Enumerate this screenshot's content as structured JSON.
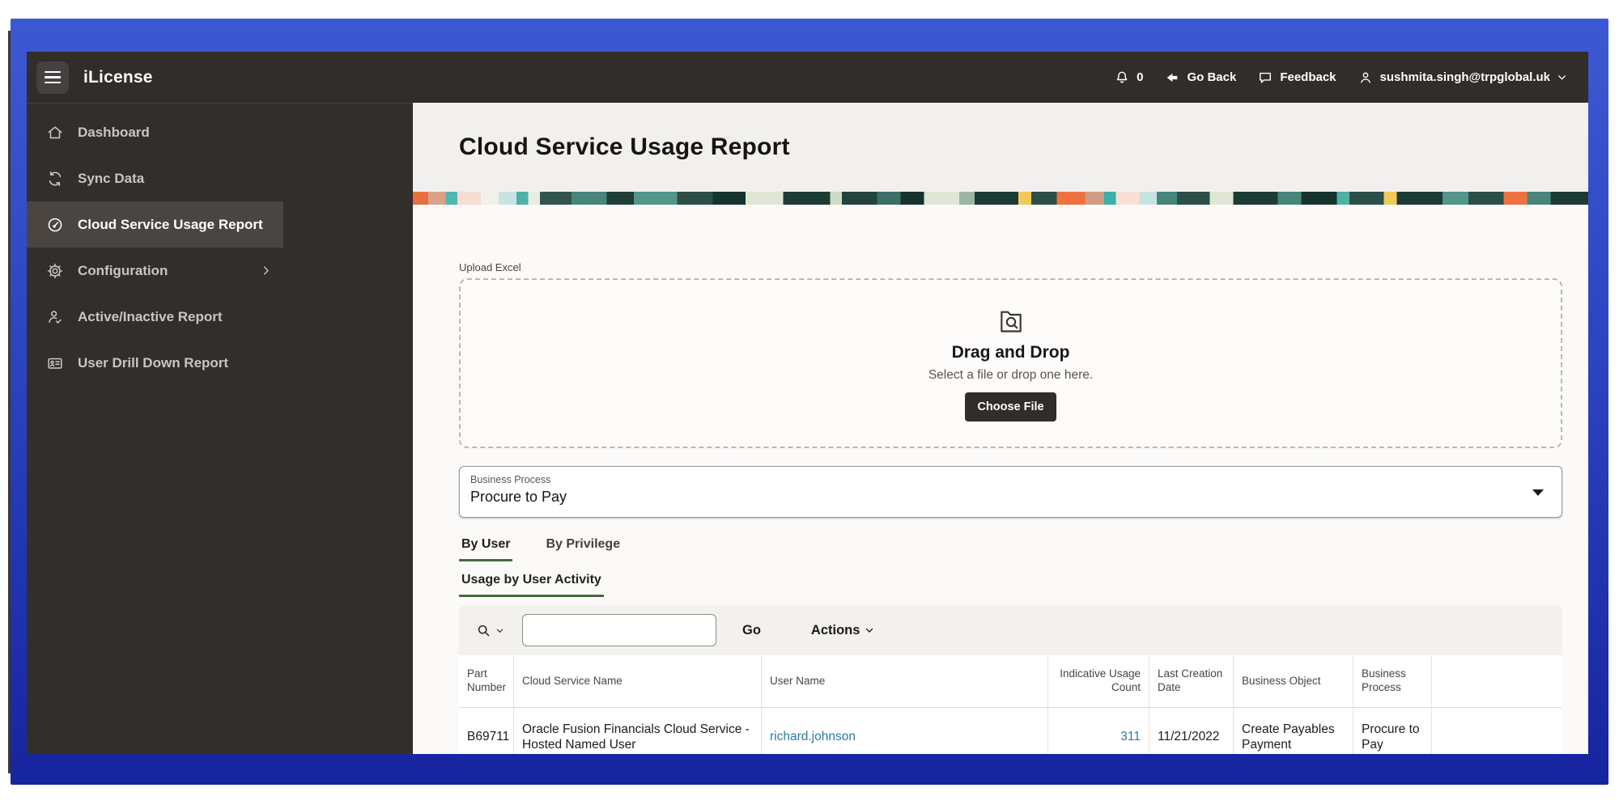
{
  "app": {
    "title": "iLicense"
  },
  "header": {
    "notifications_count": "0",
    "go_back_label": "Go Back",
    "feedback_label": "Feedback",
    "user_email": "sushmita.singh@trpglobal.uk"
  },
  "sidebar": {
    "items": [
      {
        "label": "Dashboard",
        "icon": "home-icon",
        "active": false
      },
      {
        "label": "Sync Data",
        "icon": "sync-icon",
        "active": false
      },
      {
        "label": "Cloud Service Usage Report",
        "icon": "gauge-icon",
        "active": true
      },
      {
        "label": "Configuration",
        "icon": "gear-icon",
        "active": false,
        "has_submenu": true
      },
      {
        "label": "Active/Inactive Report",
        "icon": "person-check-icon",
        "active": false
      },
      {
        "label": "User Drill Down Report",
        "icon": "id-card-icon",
        "active": false
      }
    ]
  },
  "page": {
    "title": "Cloud Service Usage Report",
    "upload": {
      "label": "Upload Excel",
      "heading": "Drag and Drop",
      "subtext": "Select a file or drop one here.",
      "button_label": "Choose File"
    },
    "business_process": {
      "label": "Business Process",
      "value": "Procure to Pay"
    },
    "tabs": [
      {
        "label": "By User",
        "active": true
      },
      {
        "label": "By Privilege",
        "active": false
      }
    ],
    "subtab": "Usage by User Activity",
    "toolbar": {
      "search_value": "",
      "go_label": "Go",
      "actions_label": "Actions"
    },
    "table": {
      "columns": [
        "Part Number",
        "Cloud Service Name",
        "User Name",
        "Indicative Usage Count",
        "Last Creation Date",
        "Business Object",
        "Business Process"
      ],
      "rows": [
        {
          "part_number": "B69711",
          "cloud_service_name": "Oracle Fusion Financials Cloud Service - Hosted Named User",
          "user_name": "richard.johnson",
          "indicative_usage_count": "311",
          "last_creation_date": "11/21/2022",
          "business_object": "Create Payables Payment",
          "business_process": "Procure to Pay"
        }
      ]
    }
  },
  "colors": {
    "frame_blue_top": "#3d59d2",
    "frame_blue_bottom": "#16259e",
    "header_bg": "#312d2a",
    "sidebar_active_bg": "#4b4542",
    "accent_green": "#476b3f",
    "link_blue": "#2b7ba8",
    "button_dark": "#312d2a"
  }
}
